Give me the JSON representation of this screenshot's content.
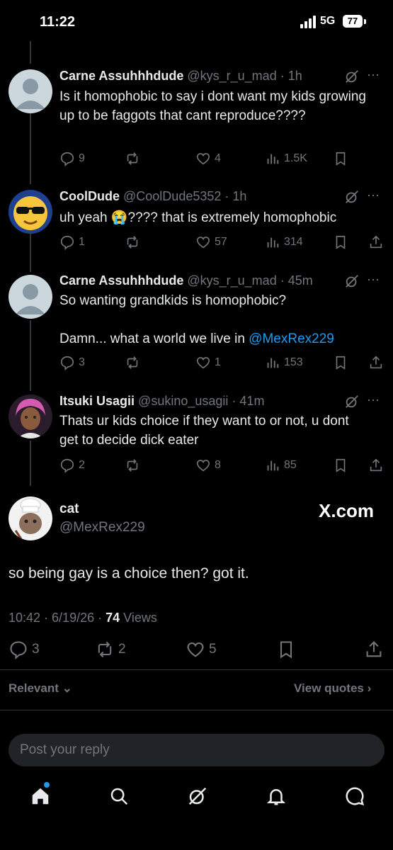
{
  "status_bar": {
    "time": "11:22",
    "network": "5G",
    "battery": "77"
  },
  "tweets": [
    {
      "name": "Carne Assuhhhdude",
      "handle": "@kys_r_u_mad",
      "time": "· 1h",
      "text": "Is it homophobic to say i dont want my kids growing up to be faggots that cant reproduce????",
      "replies": "9",
      "reposts": "",
      "likes": "4",
      "views": "1.5K"
    },
    {
      "name": "CoolDude",
      "handle": "@CoolDude5352",
      "time": "· 1h",
      "text": "uh yeah 😭???? that is extremely homophobic",
      "replies": "1",
      "reposts": "",
      "likes": "57",
      "views": "314"
    },
    {
      "name": "Carne Assuhhhdude",
      "handle": "@kys_r_u_mad",
      "time": "· 45m",
      "text_line1": "So wanting grandkids is homophobic?",
      "text_line2": "Damn... what a world we live in",
      "mention": "@MexRex229",
      "replies": "3",
      "reposts": "",
      "likes": "1",
      "views": "153"
    },
    {
      "name": "Itsuki Usagii",
      "handle": "@sukino_usagii",
      "time": "· 41m",
      "text": "Thats ur kids choice if they want to or not, u dont get to decide dick eater",
      "replies": "2",
      "reposts": "",
      "likes": "8",
      "views": "85"
    }
  ],
  "main_tweet": {
    "name": "cat",
    "handle": "@MexRex229",
    "watermark": "X.com",
    "text": "so being gay is a choice then? got it.",
    "time_date": "10:42 · 6/19/26 ·",
    "views_count": "74",
    "views_label": "Views",
    "replies": "3",
    "reposts": "2",
    "likes": "5"
  },
  "sort": {
    "label": "Relevant",
    "view_quotes": "View quotes"
  },
  "reply": {
    "placeholder": "Post your reply"
  },
  "colors": {
    "background": "#000000",
    "accent": "#1d9bf0",
    "muted": "#71767b",
    "text": "#e7e9ea"
  },
  "icons": [
    "reply-icon",
    "repost-icon",
    "like-icon",
    "views-icon",
    "bookmark-icon",
    "share-icon",
    "grok-icon",
    "more-icon",
    "home-icon",
    "search-icon",
    "grok-nav-icon",
    "notifications-icon",
    "messages-icon"
  ]
}
